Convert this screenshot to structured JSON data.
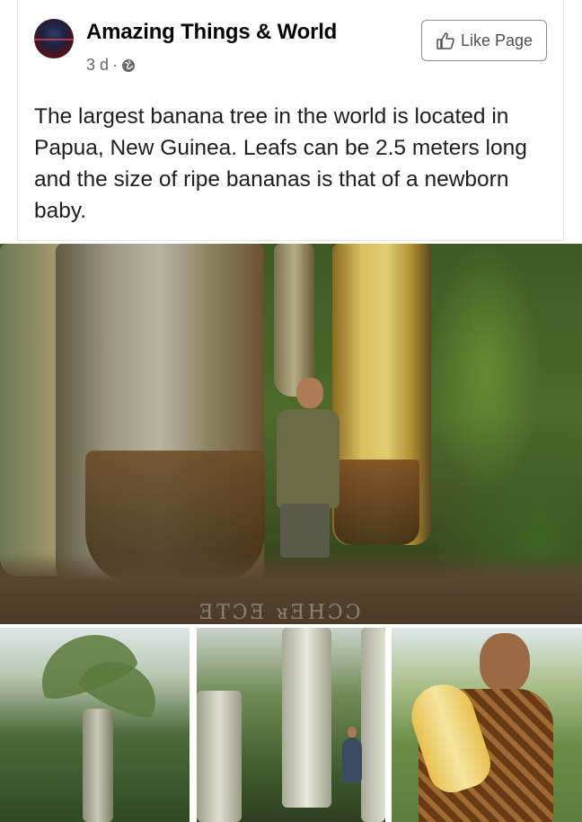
{
  "post": {
    "page_name": "Amazing Things & World",
    "age": "3 d",
    "separator": "·",
    "audience_icon": "globe-icon",
    "like_page_label": "Like Page",
    "like_icon": "thumbs-up-icon",
    "text": "The largest banana tree in the world is located in Papua, New Guinea. Leafs can be 2.5 meters long and the size of ripe bananas is that of a newborn baby."
  },
  "photos": {
    "watermark": "ƎTƆƎ ᴚƎHƆƆ"
  },
  "colors": {
    "text": "#1c1e21",
    "meta": "#65676b",
    "button_border": "#8a8d91"
  }
}
